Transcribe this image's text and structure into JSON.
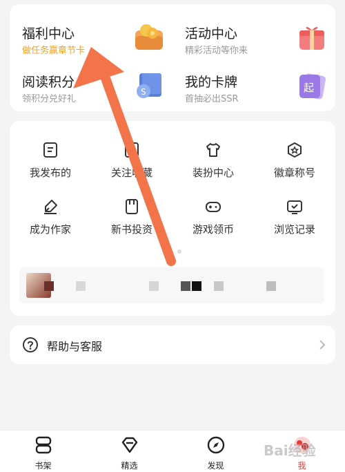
{
  "top_entries": [
    {
      "title": "福利中心",
      "subtitle": "做任务赢章节卡",
      "icon": "coin-wallet-icon"
    },
    {
      "title": "活动中心",
      "subtitle": "精彩活动等你来",
      "icon": "gift-box-icon"
    },
    {
      "title": "阅读积分",
      "subtitle": "领积分兑好礼",
      "icon": "points-book-icon"
    },
    {
      "title": "我的卡牌",
      "subtitle": "首抽必出SSR",
      "icon": "card-icon"
    }
  ],
  "grid": [
    {
      "label": "我发布的",
      "icon": "document-icon"
    },
    {
      "label": "关注收藏",
      "icon": "bookmark-icon"
    },
    {
      "label": "装扮中心",
      "icon": "shirt-icon"
    },
    {
      "label": "徽章称号",
      "icon": "badge-icon"
    },
    {
      "label": "成为作家",
      "icon": "pen-icon"
    },
    {
      "label": "新书投资",
      "icon": "new-book-icon"
    },
    {
      "label": "游戏领币",
      "icon": "gamepad-icon"
    },
    {
      "label": "浏览记录",
      "icon": "history-icon"
    }
  ],
  "help": {
    "label": "帮助与客服",
    "icon": "question-icon"
  },
  "tabs": [
    {
      "label": "书架",
      "icon": "bookshelf-icon"
    },
    {
      "label": "精选",
      "icon": "diamond-icon"
    },
    {
      "label": "发现",
      "icon": "compass-icon"
    },
    {
      "label": "我",
      "icon": "avatar-icon"
    }
  ],
  "watermark": "Bai经验",
  "colors": {
    "accent": "#e83a3a",
    "gold": "#f0a21f",
    "arrow": "#f3744a"
  }
}
